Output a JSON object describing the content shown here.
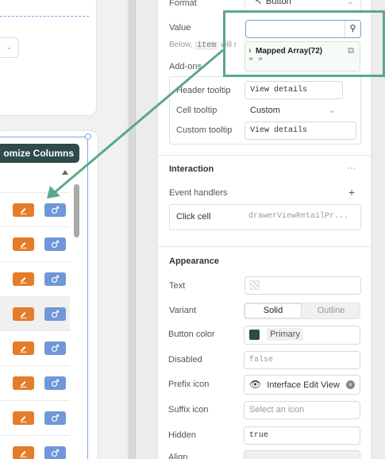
{
  "left": {
    "customize_columns_label": "omize Columns"
  },
  "inspector": {
    "format": {
      "label": "Format",
      "value": "Button"
    },
    "value": {
      "label": "Value",
      "help_prefix": "Below,",
      "help_code": "item",
      "help_suffix": "will r"
    },
    "mapped_array": {
      "title": "Mapped Array(72)",
      "preview": "\" \""
    },
    "addons": {
      "label": "Add-ons",
      "header_tooltip": {
        "label": "Header tooltip",
        "value": "View details"
      },
      "cell_tooltip": {
        "label": "Cell tooltip",
        "value": "Custom"
      },
      "custom_tooltip": {
        "label": "Custom tooltip",
        "value": "View details"
      }
    },
    "interaction": {
      "title": "Interaction",
      "more": "···",
      "event_handlers": "Event handlers",
      "add": "+",
      "handler": {
        "event": "Click cell",
        "action": "drawerViewRetailPr..."
      }
    },
    "appearance": {
      "title": "Appearance",
      "text_label": "Text",
      "variant_label": "Variant",
      "variant_options": [
        "Solid",
        "Outline"
      ],
      "variant_selected": "Solid",
      "button_color": {
        "label": "Button color",
        "value": "Primary",
        "swatch": "#2e4a4a"
      },
      "disabled": {
        "label": "Disabled",
        "value": "false"
      },
      "prefix_icon": {
        "label": "Prefix icon",
        "value": "Interface Edit View"
      },
      "suffix_icon": {
        "label": "Suffix icon",
        "placeholder": "Select an icon"
      },
      "hidden": {
        "label": "Hidden",
        "value": "true"
      },
      "align_label": "Align"
    }
  },
  "colors": {
    "edit_button": "#e57c2a",
    "view_button": "#7097d8",
    "annotation": "#5aa888",
    "selection": "#7aa7e0"
  }
}
